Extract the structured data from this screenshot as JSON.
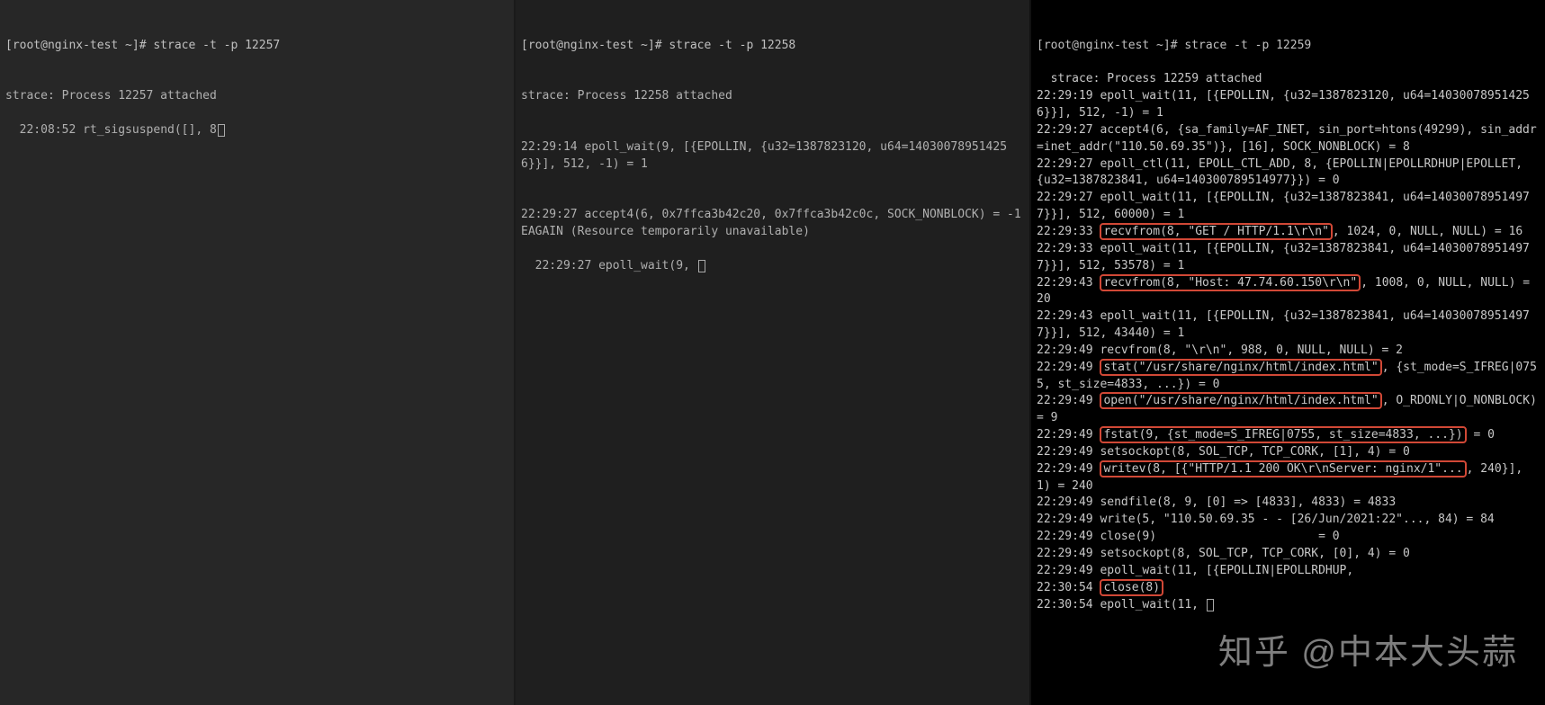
{
  "pane1": {
    "prompt": "[root@nginx-test ~]# strace -t -p 12257",
    "lines": [
      "strace: Process 12257 attached",
      "22:08:52 rt_sigsuspend([], 8"
    ]
  },
  "pane2": {
    "prompt": "[root@nginx-test ~]# strace -t -p 12258",
    "lines": [
      "strace: Process 12258 attached",
      "22:29:14 epoll_wait(9, [{EPOLLIN, {u32=1387823120, u64=140300789514256}}], 512, -1) = 1",
      "22:29:27 accept4(6, 0x7ffca3b42c20, 0x7ffca3b42c0c, SOCK_NONBLOCK) = -1 EAGAIN (Resource temporarily unavailable)",
      "22:29:27 epoll_wait(9, "
    ]
  },
  "pane3": {
    "prompt": "[root@nginx-test ~]# strace -t -p 12259",
    "segments": [
      {
        "t": "plain",
        "v": "strace: Process 12259 attached\n"
      },
      {
        "t": "plain",
        "v": "22:29:19 epoll_wait(11, [{EPOLLIN, {u32=1387823120, u64=140300789514256}}], 512, -1) = 1\n"
      },
      {
        "t": "plain",
        "v": "22:29:27 accept4(6, {sa_family=AF_INET, sin_port=htons(49299), sin_addr=inet_addr(\"110.50.69.35\")}, [16], SOCK_NONBLOCK) = 8\n"
      },
      {
        "t": "plain",
        "v": "22:29:27 epoll_ctl(11, EPOLL_CTL_ADD, 8, {EPOLLIN|EPOLLRDHUP|EPOLLET, {u32=1387823841, u64=140300789514977}}) = 0\n"
      },
      {
        "t": "plain",
        "v": "22:29:27 epoll_wait(11, [{EPOLLIN, {u32=1387823841, u64=140300789514977}}], 512, 60000) = 1\n"
      },
      {
        "t": "plain",
        "v": "22:29:33 "
      },
      {
        "t": "hl",
        "v": "recvfrom(8, \"GET / HTTP/1.1\\r\\n\""
      },
      {
        "t": "plain",
        "v": ", 1024, 0, NULL, NULL) = 16\n"
      },
      {
        "t": "plain",
        "v": "22:29:33 epoll_wait(11, [{EPOLLIN, {u32=1387823841, u64=140300789514977}}], 512, 53578) = 1\n"
      },
      {
        "t": "plain",
        "v": "22:29:43 "
      },
      {
        "t": "hl",
        "v": "recvfrom(8, \"Host: 47.74.60.150\\r\\n\""
      },
      {
        "t": "plain",
        "v": ", 1008, 0, NULL, NULL) = 20\n"
      },
      {
        "t": "plain",
        "v": "22:29:43 epoll_wait(11, [{EPOLLIN, {u32=1387823841, u64=140300789514977}}], 512, 43440) = 1\n"
      },
      {
        "t": "plain",
        "v": "22:29:49 recvfrom(8, \"\\r\\n\", 988, 0, NULL, NULL) = 2\n"
      },
      {
        "t": "plain",
        "v": "22:29:49 "
      },
      {
        "t": "hl",
        "v": "stat(\"/usr/share/nginx/html/index.html\""
      },
      {
        "t": "plain",
        "v": ", {st_mode=S_IFREG|0755, st_size=4833, ...}) = 0\n"
      },
      {
        "t": "plain",
        "v": "22:29:49 "
      },
      {
        "t": "hl",
        "v": "open(\"/usr/share/nginx/html/index.html\""
      },
      {
        "t": "plain",
        "v": ", O_RDONLY|O_NONBLOCK) = 9\n"
      },
      {
        "t": "plain",
        "v": "22:29:49 "
      },
      {
        "t": "hl",
        "v": "fstat(9, {st_mode=S_IFREG|0755, st_size=4833, ...})"
      },
      {
        "t": "plain",
        "v": " = 0\n"
      },
      {
        "t": "plain",
        "v": "22:29:49 setsockopt(8, SOL_TCP, TCP_CORK, [1], 4) = 0\n"
      },
      {
        "t": "plain",
        "v": "22:29:49 "
      },
      {
        "t": "hl",
        "v": "writev(8, [{\"HTTP/1.1 200 OK\\r\\nServer: nginx/1\"..."
      },
      {
        "t": "plain",
        "v": ", 240}], 1) = 240\n"
      },
      {
        "t": "plain",
        "v": "22:29:49 sendfile(8, 9, [0] => [4833], 4833) = 4833\n"
      },
      {
        "t": "plain",
        "v": "22:29:49 write(5, \"110.50.69.35 - - [26/Jun/2021:22\"..., 84) = 84\n"
      },
      {
        "t": "plain",
        "v": "22:29:49 close(9)                       = 0\n"
      },
      {
        "t": "plain",
        "v": "22:29:49 setsockopt(8, SOL_TCP, TCP_CORK, [0], 4) = 0\n"
      },
      {
        "t": "plain",
        "v": "22:29:49 epoll_wait(11, [{EPOLLIN|EPOLLRDHUP,    \n"
      },
      {
        "t": "plain",
        "v": "22:30:54 "
      },
      {
        "t": "hl",
        "v": "close(8)"
      },
      {
        "t": "plain",
        "v": "\n"
      },
      {
        "t": "plain",
        "v": "22:30:54 epoll_wait(11, "
      }
    ]
  },
  "watermark": "知乎 @中本大头蒜"
}
